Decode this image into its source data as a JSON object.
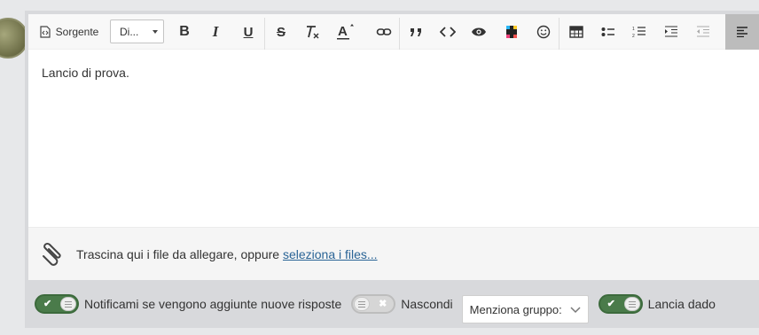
{
  "toolbar": {
    "source_label": "Sorgente",
    "format_label": "Di...",
    "bold_glyph": "B",
    "italic_glyph": "I",
    "underline_glyph": "U",
    "strike_glyph": "S",
    "textcolor_glyph": "A",
    "quote_glyph": "”"
  },
  "editor": {
    "content": "Lancio di prova."
  },
  "attach": {
    "text": "Trascina qui i file da allegare, oppure ",
    "link": "seleziona i files..."
  },
  "footer": {
    "notify_label": "Notificami se vengono aggiunte nuove risposte",
    "hide_label": "Nascondi",
    "mention_select": "Menziona gruppo:",
    "dice_label": "Lancia dado",
    "check_mark": "✔",
    "cross_mark": "✖"
  },
  "colors": {
    "toggle_on": "#4a7b4a",
    "toggle_off": "#d6d6d6",
    "link": "#2a6496"
  }
}
